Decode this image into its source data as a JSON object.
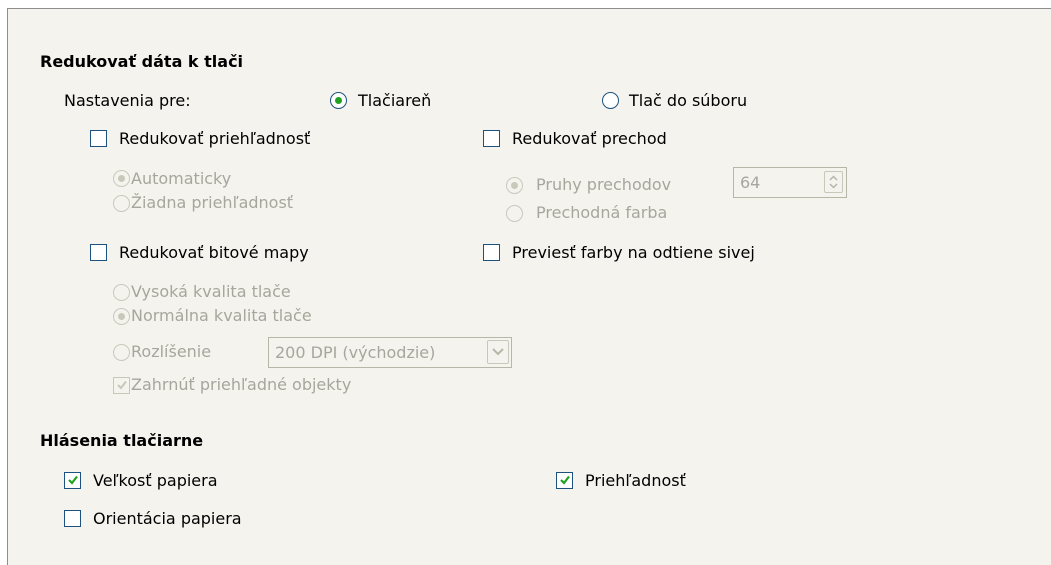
{
  "reduce": {
    "title": "Redukovať dáta k tlači",
    "settings_for": {
      "label": "Nastavenia pre:",
      "printer": {
        "label": "Tlačiareň",
        "underline": "T",
        "checked": true
      },
      "file": {
        "label": "Tlač do súboru",
        "underline": "b",
        "checked": false
      }
    },
    "transparency": {
      "label": "Redukovať priehľadnosť",
      "checked": false,
      "options": [
        {
          "label": "Automaticky",
          "checked": true
        },
        {
          "label": "Žiadna priehľadnosť",
          "checked": false
        }
      ]
    },
    "gradient": {
      "label": "Redukovať prechod",
      "checked": false,
      "options": [
        {
          "label": "Pruhy prechodov",
          "checked": true
        },
        {
          "label": "Prechodná farba",
          "checked": false
        }
      ],
      "stripes_value": "64"
    },
    "bitmaps": {
      "label": "Redukovať bitové mapy",
      "checked": false,
      "options": [
        {
          "label": "Vysoká kvalita tlače",
          "checked": false
        },
        {
          "label": "Normálna kvalita tlače",
          "checked": true
        },
        {
          "label": "Rozlíšenie",
          "checked": false
        }
      ],
      "resolution_value": "200 DPI (východzie)",
      "include_transparent": {
        "label": "Zahrnúť priehľadné objekty",
        "checked": true
      }
    },
    "grayscale": {
      "label": "Previesť farby na odtiene sivej",
      "checked": false
    }
  },
  "warnings": {
    "title": "Hlásenia tlačiarne",
    "paper_size": {
      "label": "Veľkosť papiera",
      "checked": true
    },
    "paper_orientation": {
      "label": "Orientácia papiera",
      "checked": false
    },
    "transparency": {
      "label": "Priehľadnosť",
      "checked": true
    }
  },
  "colors": {
    "accent_check": "#21a121",
    "border": "#1c5180",
    "disabled_text": "#a7a69c"
  }
}
